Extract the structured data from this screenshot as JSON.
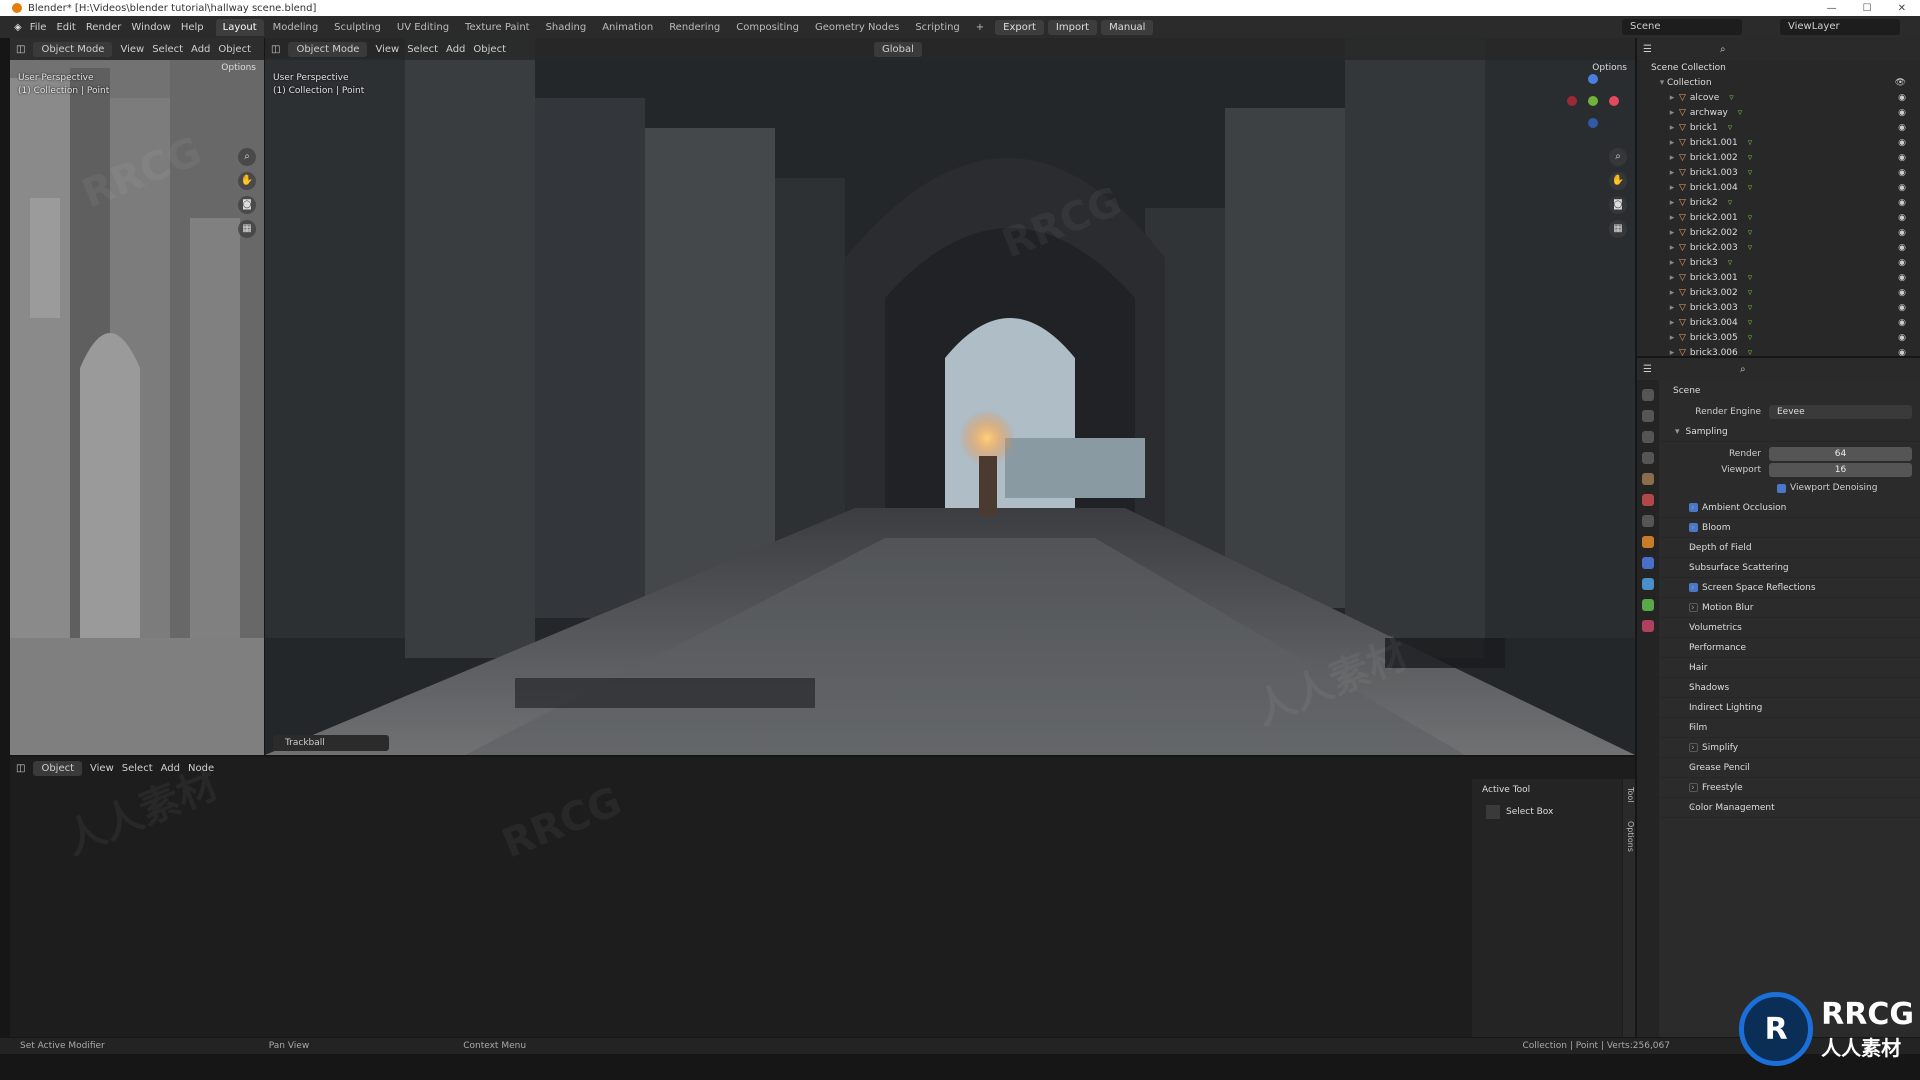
{
  "titlebar": {
    "text": "Blender* [H:\\Videos\\blender tutorial\\hallway scene.blend]"
  },
  "menu": [
    "File",
    "Edit",
    "Render",
    "Window",
    "Help"
  ],
  "workspaces": [
    "Layout",
    "Modeling",
    "Sculpting",
    "UV Editing",
    "Texture Paint",
    "Shading",
    "Animation",
    "Rendering",
    "Compositing",
    "Geometry Nodes",
    "Scripting"
  ],
  "active_workspace": "Layout",
  "top_buttons": {
    "export": "Export",
    "import": "Import",
    "manual": "Manual"
  },
  "scene_name": "Scene",
  "viewlayer_name": "ViewLayer",
  "left_viewport": {
    "mode": "Object Mode",
    "menus": [
      "View",
      "Select",
      "Add",
      "Object"
    ],
    "options": "Options",
    "overlay_line1": "User Perspective",
    "overlay_line2": "(1) Collection | Point"
  },
  "main_viewport": {
    "mode": "Object Mode",
    "menus": [
      "View",
      "Select",
      "Add",
      "Object"
    ],
    "orientation": "Global",
    "options": "Options",
    "overlay_line1": "User Perspective",
    "overlay_line2": "(1) Collection | Point",
    "last_op": "Trackball"
  },
  "node_editor": {
    "mode": "Object",
    "menus": [
      "View",
      "Select",
      "Add",
      "Node"
    ],
    "active_tool_title": "Active Tool",
    "tool_name": "Select Box",
    "side_tabs": [
      "Tool",
      "Options"
    ]
  },
  "outliner": {
    "root": "Scene Collection",
    "collection": "Collection",
    "items": [
      "alcove",
      "archway",
      "brick1",
      "brick1.001",
      "brick1.002",
      "brick1.003",
      "brick1.004",
      "brick2",
      "brick2.001",
      "brick2.002",
      "brick2.003",
      "brick3",
      "brick3.001",
      "brick3.002",
      "brick3.003",
      "brick3.004",
      "brick3.005",
      "brick3.006"
    ]
  },
  "properties": {
    "context": "Scene",
    "render_engine_label": "Render Engine",
    "render_engine": "Eevee",
    "sampling": "Sampling",
    "render_label": "Render",
    "render_value": "64",
    "viewport_label": "Viewport",
    "viewport_value": "16",
    "viewport_denoising": "Viewport Denoising",
    "panels": [
      {
        "label": "Ambient Occlusion",
        "checkbox": true,
        "checked": true
      },
      {
        "label": "Bloom",
        "checkbox": true,
        "checked": true
      },
      {
        "label": "Depth of Field",
        "checkbox": false,
        "checked": false
      },
      {
        "label": "Subsurface Scattering",
        "checkbox": false,
        "checked": false
      },
      {
        "label": "Screen Space Reflections",
        "checkbox": true,
        "checked": true
      },
      {
        "label": "Motion Blur",
        "checkbox": true,
        "checked": false
      },
      {
        "label": "Volumetrics",
        "checkbox": false,
        "checked": false
      },
      {
        "label": "Performance",
        "checkbox": false,
        "checked": false
      },
      {
        "label": "Hair",
        "checkbox": false,
        "checked": false
      },
      {
        "label": "Shadows",
        "checkbox": false,
        "checked": false
      },
      {
        "label": "Indirect Lighting",
        "checkbox": false,
        "checked": false
      },
      {
        "label": "Film",
        "checkbox": false,
        "checked": false
      },
      {
        "label": "Simplify",
        "checkbox": true,
        "checked": false
      },
      {
        "label": "Grease Pencil",
        "checkbox": false,
        "checked": false
      },
      {
        "label": "Freestyle",
        "checkbox": true,
        "checked": false
      },
      {
        "label": "Color Management",
        "checkbox": false,
        "checked": false
      }
    ]
  },
  "statusbar": {
    "left1": "Set Active Modifier",
    "left2": "Pan View",
    "left3": "Context Menu",
    "right": "Collection | Point | Verts:256,067"
  },
  "watermark": {
    "a": "RRCG",
    "b": "人人素材"
  },
  "logo": {
    "text1": "RRCG",
    "text2": "人人素材"
  },
  "colors": {
    "accent": "#4a78c8",
    "object": "#e7a15a",
    "header": "#2a2a2a",
    "panel": "#303030"
  }
}
